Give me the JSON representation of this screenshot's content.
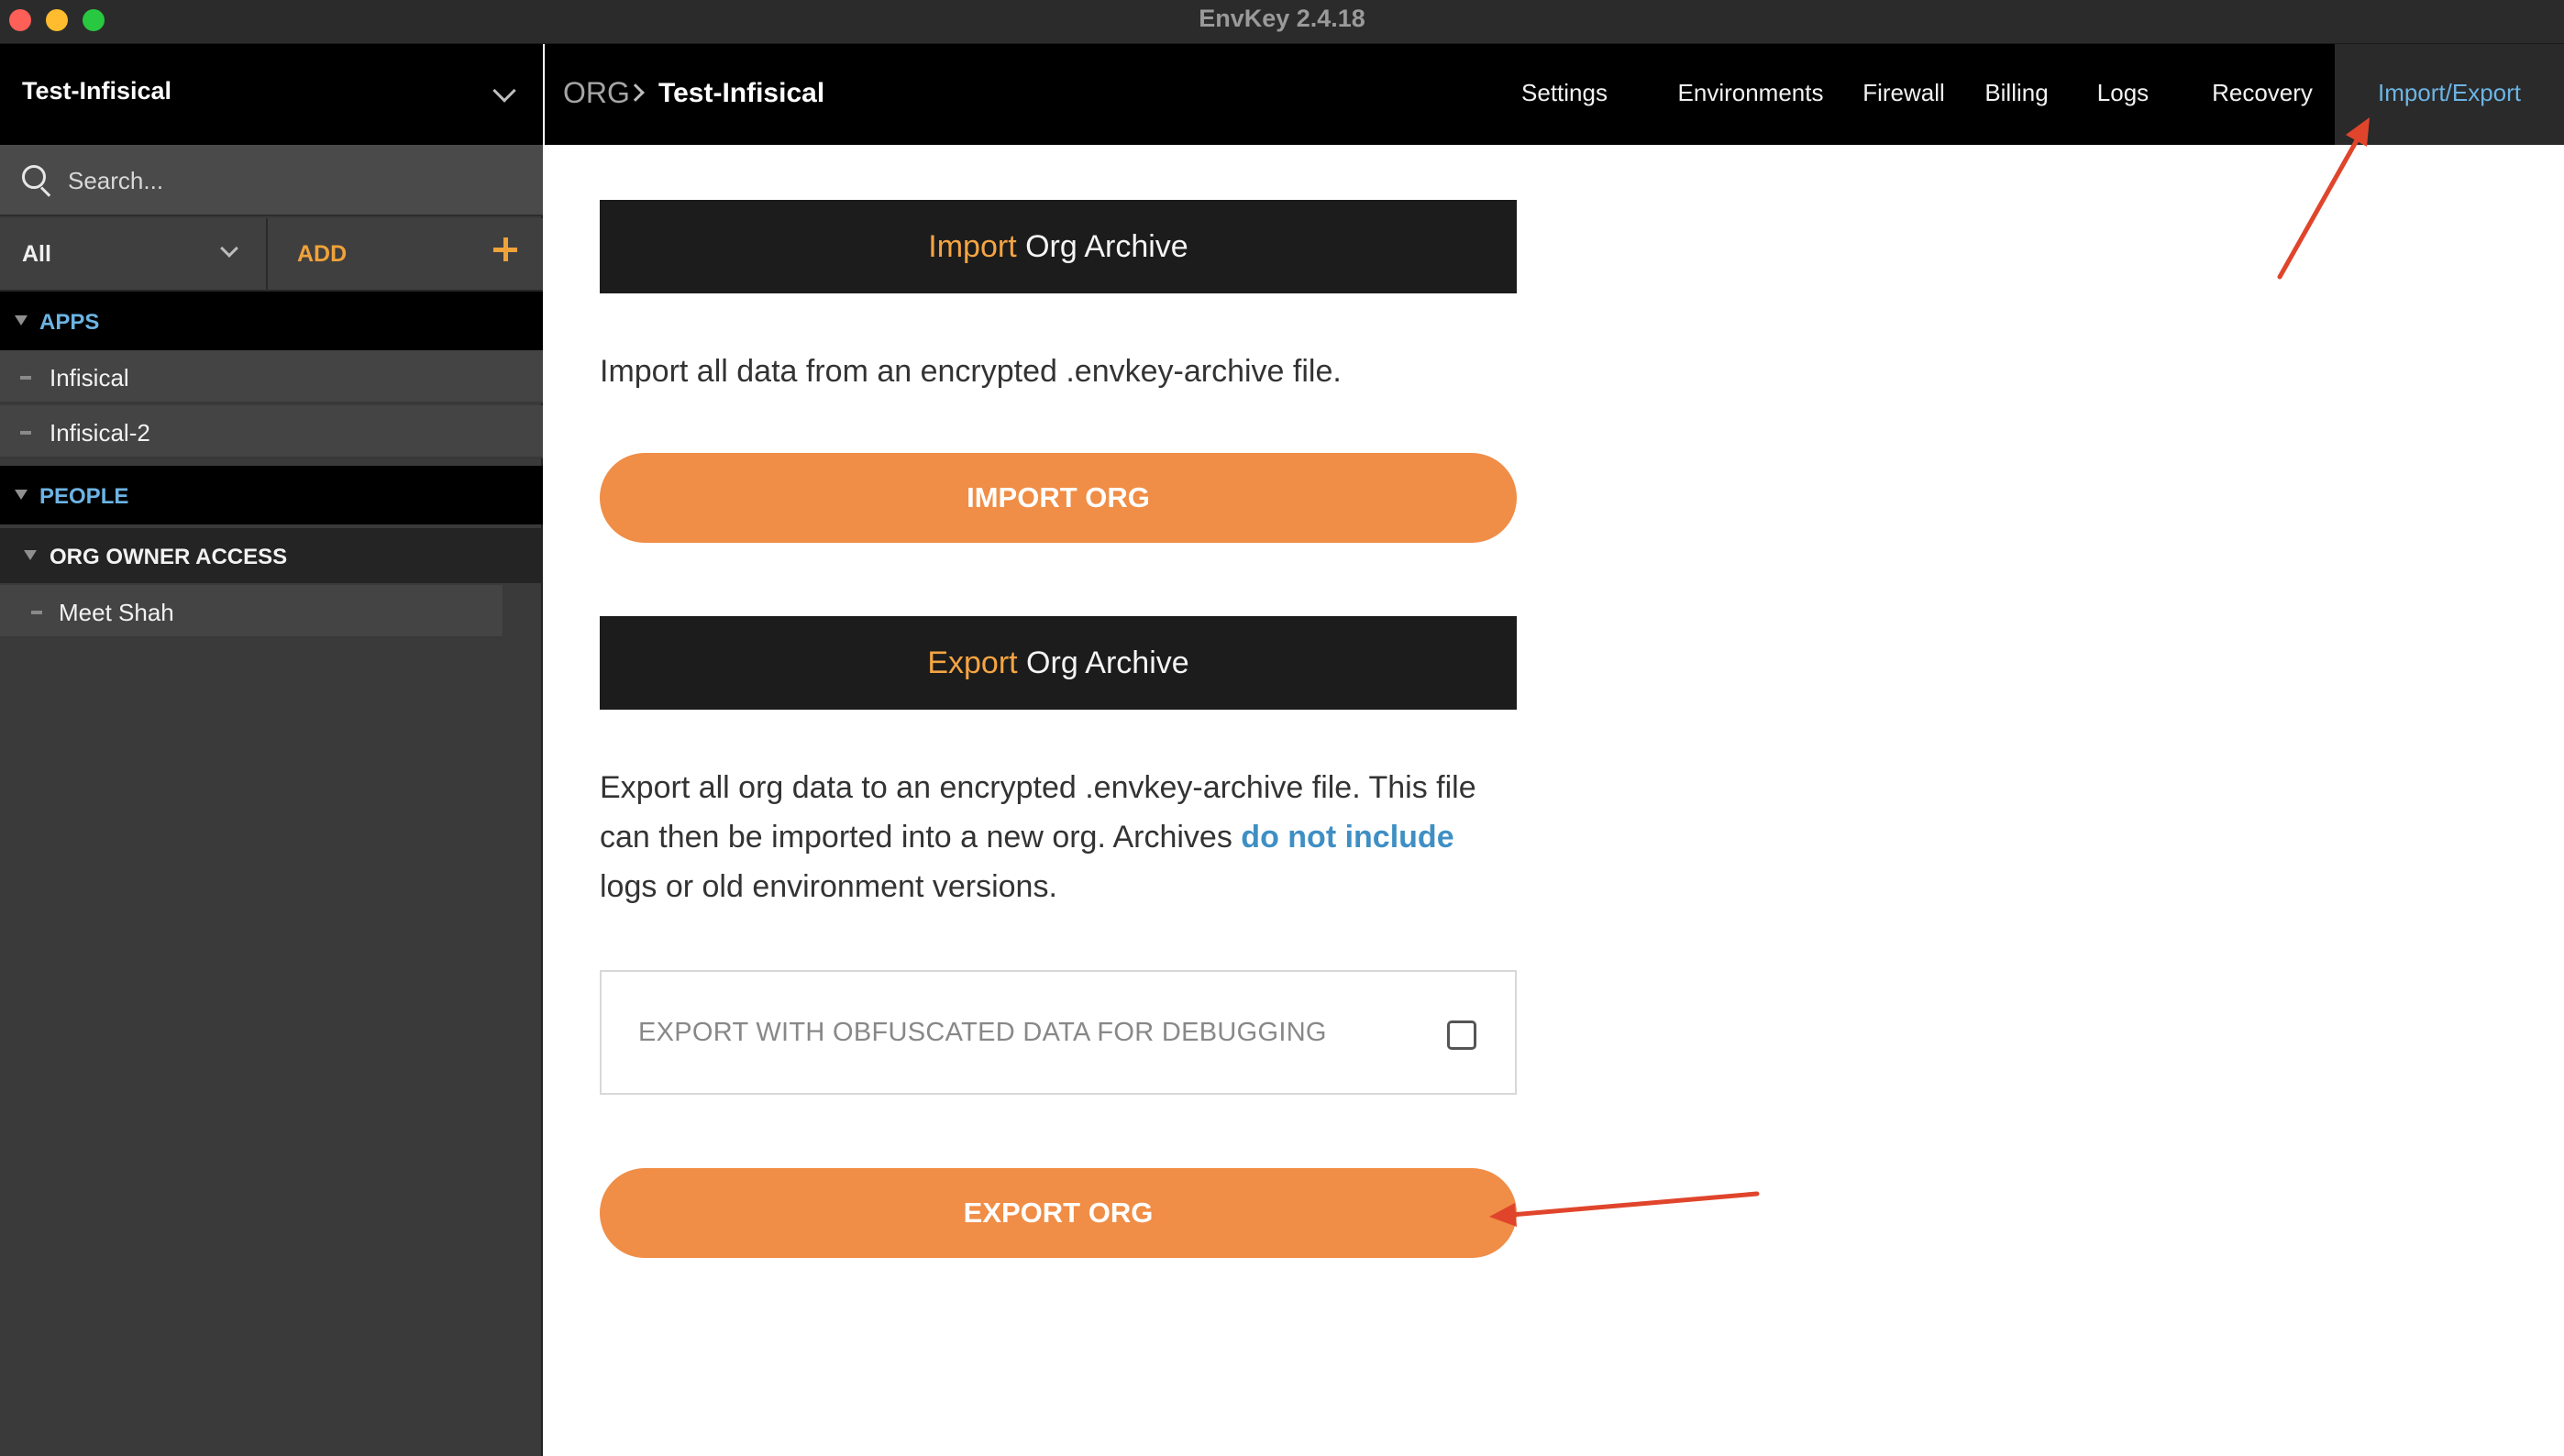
{
  "window": {
    "title": "EnvKey 2.4.18"
  },
  "sidebar": {
    "org_name": "Test-Infisical",
    "search_placeholder": "Search...",
    "filter_label": "All",
    "add_label": "ADD",
    "apps_heading": "APPS",
    "apps": [
      {
        "label": "Infisical"
      },
      {
        "label": "Infisical-2"
      }
    ],
    "people_heading": "PEOPLE",
    "owner_access_heading": "ORG OWNER ACCESS",
    "people": [
      {
        "label": "Meet Shah"
      }
    ]
  },
  "header": {
    "breadcrumb_root": "ORG",
    "breadcrumb_name": "Test-Infisical",
    "tabs": [
      {
        "label": "Settings"
      },
      {
        "label": "Environments"
      },
      {
        "label": "Firewall"
      },
      {
        "label": "Billing"
      },
      {
        "label": "Logs"
      },
      {
        "label": "Recovery"
      },
      {
        "label": "Import/Export"
      }
    ],
    "active_tab": "Import/Export"
  },
  "import_section": {
    "title_accent": "Import",
    "title_rest": "Org Archive",
    "description": "Import all data from an encrypted .envkey-archive file.",
    "button_label": "IMPORT ORG"
  },
  "export_section": {
    "title_accent": "Export",
    "title_rest": "Org Archive",
    "description_line1": "Export all org data to an encrypted .envkey-archive file. This file",
    "description_line2_pre": "can then be imported into a new org. Archives ",
    "description_link": "do not include",
    "description_line3": "logs or old environment versions.",
    "obfuscate_label": "EXPORT WITH OBFUSCATED DATA FOR DEBUGGING",
    "obfuscate_checked": false,
    "button_label": "EXPORT ORG"
  },
  "colors": {
    "accent_orange": "#f08d46",
    "title_orange": "#f5a442",
    "link_blue": "#3f8fc4",
    "active_tab_blue": "#6cb4e4",
    "annotation_red": "#e0452c"
  }
}
